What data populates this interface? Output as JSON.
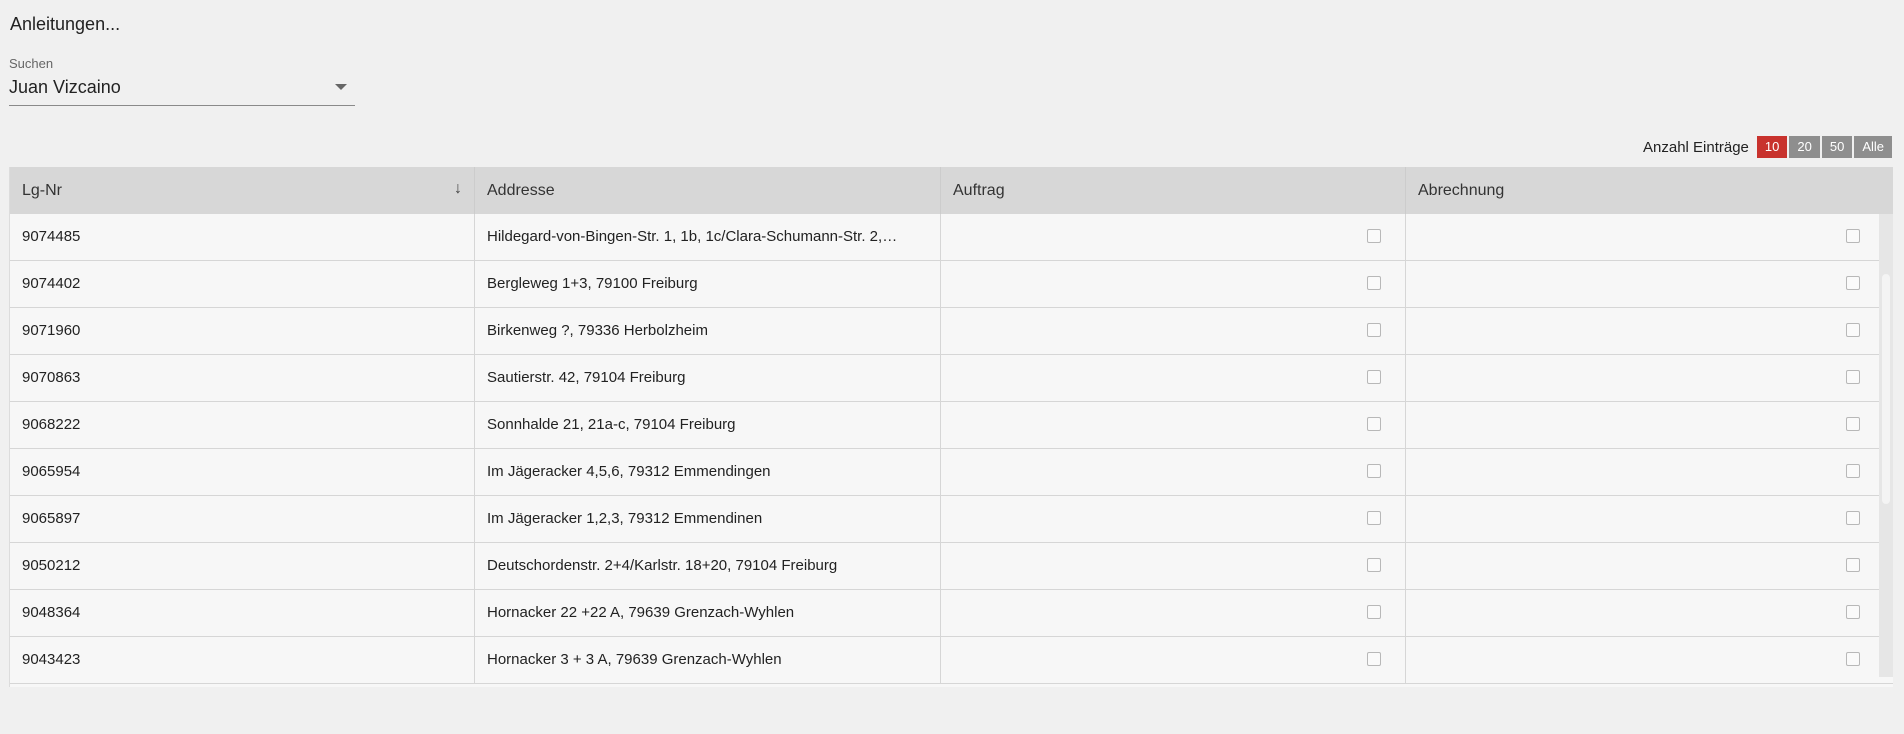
{
  "page": {
    "title": "Anleitungen..."
  },
  "search": {
    "label": "Suchen",
    "value": "Juan Vizcaino"
  },
  "entries": {
    "label": "Anzahl Einträge",
    "options": [
      "10",
      "20",
      "50",
      "Alle"
    ],
    "selected": "10"
  },
  "table": {
    "columns": [
      "Lg-Nr",
      "Addresse",
      "Auftrag",
      "Abrechnung"
    ],
    "sort_icon": "arrow-down-icon",
    "rows": [
      {
        "lg_nr": "9074485",
        "address": "Hildegard-von-Bingen-Str. 1, 1b, 1c/Clara-Schumann-Str. 2,…"
      },
      {
        "lg_nr": "9074402",
        "address": "Bergleweg 1+3, 79100 Freiburg"
      },
      {
        "lg_nr": "9071960",
        "address": "Birkenweg ?, 79336 Herbolzheim"
      },
      {
        "lg_nr": "9070863",
        "address": "Sautierstr. 42, 79104 Freiburg"
      },
      {
        "lg_nr": "9068222",
        "address": "Sonnhalde 21, 21a-c, 79104 Freiburg"
      },
      {
        "lg_nr": "9065954",
        "address": "Im Jägeracker 4,5,6, 79312 Emmendingen"
      },
      {
        "lg_nr": "9065897",
        "address": "Im Jägeracker 1,2,3, 79312 Emmendinen"
      },
      {
        "lg_nr": "9050212",
        "address": "Deutschordenstr. 2+4/Karlstr. 18+20, 79104 Freiburg"
      },
      {
        "lg_nr": "9048364",
        "address": "Hornacker 22 +22 A, 79639 Grenzach-Wyhlen"
      },
      {
        "lg_nr": "9043423",
        "address": "Hornacker 3 + 3 A, 79639 Grenzach-Wyhlen"
      }
    ]
  },
  "colors": {
    "accent": "#c8322d",
    "button_inactive": "#8e8e8e",
    "header_bg": "#d7d7d7"
  }
}
